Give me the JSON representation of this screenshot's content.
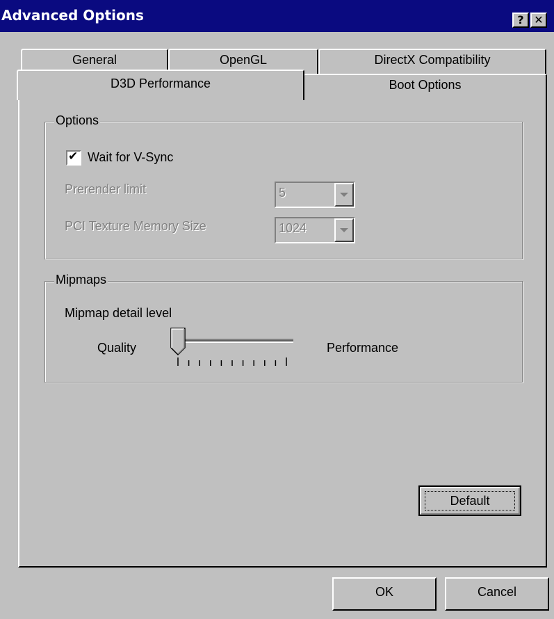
{
  "window": {
    "title": "Advanced Options",
    "help_glyph": "?",
    "close_glyph": "✕"
  },
  "tabs": {
    "row_back": [
      {
        "label": "General"
      },
      {
        "label": "OpenGL"
      },
      {
        "label": "DirectX Compatibility"
      }
    ],
    "row_front": [
      {
        "label": "D3D Performance",
        "selected": true
      },
      {
        "label": "Boot Options",
        "selected": false
      }
    ]
  },
  "options_group": {
    "legend": "Options",
    "vsync": {
      "label": "Wait for V-Sync",
      "checked": true,
      "check_glyph": "✔"
    },
    "prerender": {
      "label": "Prerender limit",
      "value": "5",
      "enabled": false
    },
    "pci_texture": {
      "label": "PCI Texture Memory Size",
      "value": "1024",
      "enabled": false
    }
  },
  "mipmaps_group": {
    "legend": "Mipmaps",
    "detail_label": "Mipmap detail level",
    "left_label": "Quality",
    "right_label": "Performance",
    "slider": {
      "position": 0,
      "ticks": 11
    }
  },
  "buttons": {
    "default": "Default",
    "ok": "OK",
    "cancel": "Cancel"
  },
  "colors": {
    "face": "#c0c0c0",
    "title_bar": "#0a0a80",
    "disabled_text": "#808080"
  }
}
